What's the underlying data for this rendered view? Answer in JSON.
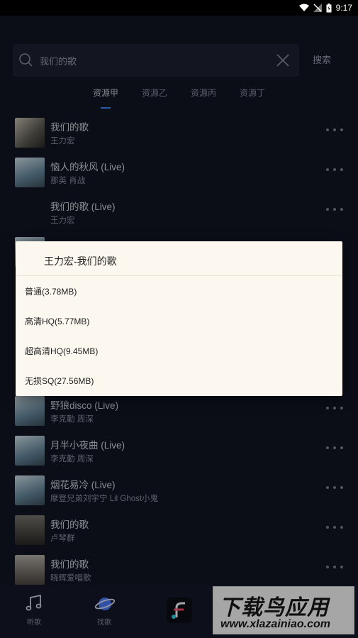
{
  "status_bar": {
    "time": "9:17"
  },
  "search": {
    "value": "我们的歌",
    "button_label": "搜索"
  },
  "tabs": [
    {
      "label": "资源甲",
      "active": true
    },
    {
      "label": "资源乙",
      "active": false
    },
    {
      "label": "资源丙",
      "active": false
    },
    {
      "label": "资源丁",
      "active": false
    }
  ],
  "songs": [
    {
      "title": "我们的歌",
      "artist": "王力宏",
      "cover": "c1"
    },
    {
      "title": "恼人的秋风 (Live)",
      "artist": "那英  肖战",
      "cover": "c2"
    },
    {
      "title": "我们的歌 (Live)",
      "artist": "王力宏",
      "cover": "none"
    },
    {
      "title": "",
      "artist": "",
      "cover": "c2"
    },
    {
      "title": "",
      "artist": "",
      "cover": "none"
    },
    {
      "title": "",
      "artist": "",
      "cover": "none"
    },
    {
      "title": "",
      "artist": "",
      "cover": "none"
    },
    {
      "title": "野狼disco (Live)",
      "artist": "李克勤  周深",
      "cover": "c2"
    },
    {
      "title": "月半小夜曲 (Live)",
      "artist": "李克勤  周深",
      "cover": "c2"
    },
    {
      "title": "烟花易冷 (Live)",
      "artist": "摩登兄弟刘宇宁  Lil Ghost小鬼",
      "cover": "c2"
    },
    {
      "title": "我们的歌",
      "artist": "卢琴群",
      "cover": "c3"
    },
    {
      "title": "我们的歌",
      "artist": "晓辉爱唱歌",
      "cover": "c4"
    }
  ],
  "dialog": {
    "title": "王力宏-我们的歌",
    "options": [
      "普通(3.78MB)",
      "高清HQ(5.77MB)",
      "超高清HQ(9.45MB)",
      "无损SQ(27.56MB)"
    ]
  },
  "bottom_nav": [
    {
      "label": "听歌",
      "icon": "music-note-icon"
    },
    {
      "label": "找歌",
      "icon": "planet-icon"
    },
    {
      "label": "",
      "icon": "app-logo-icon"
    }
  ],
  "watermark": {
    "line1": "下载鸟应用",
    "line2": "www.xlazainiao.com"
  },
  "colors": {
    "accent": "#3f8cff",
    "background": "#121624",
    "dialog": "#fdf8ef"
  }
}
